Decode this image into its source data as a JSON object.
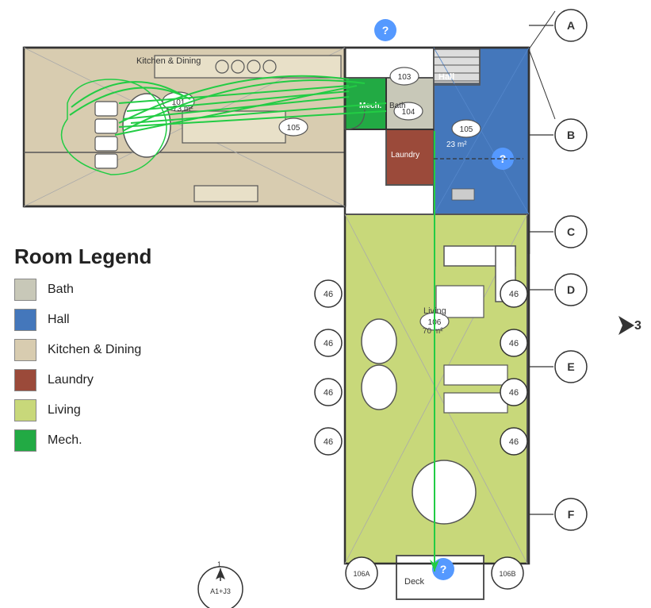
{
  "legend": {
    "title": "Room Legend",
    "items": [
      {
        "id": "bath",
        "label": "Bath",
        "color": "#c8d8c8"
      },
      {
        "id": "hall",
        "label": "Hall",
        "color": "#4477bb"
      },
      {
        "id": "kitchen-dining",
        "label": "Kitchen & Dining",
        "color": "#d8ccb0"
      },
      {
        "id": "laundry",
        "label": "Laundry",
        "color": "#9b4a3a"
      },
      {
        "id": "living",
        "label": "Living",
        "color": "#c8d87a"
      },
      {
        "id": "mech",
        "label": "Mech.",
        "color": "#22aa44"
      }
    ]
  },
  "rooms": [
    {
      "id": "kitchen-dining",
      "label": "Kitchen & Dining",
      "number": "101",
      "area": "73 m²"
    },
    {
      "id": "bath",
      "label": "Bath",
      "number": "104"
    },
    {
      "id": "hall",
      "label": "Hall",
      "number": "105",
      "area": "23 m²"
    },
    {
      "id": "living",
      "label": "Living",
      "number": "106",
      "area": "70 m²"
    },
    {
      "id": "mech",
      "label": "Mech.",
      "number": "103"
    },
    {
      "id": "laundry",
      "label": "Laundry"
    },
    {
      "id": "deck",
      "label": "Deck"
    }
  ],
  "grid_refs": {
    "right": [
      "A",
      "B",
      "C",
      "D",
      "E",
      "F"
    ],
    "bottom_number": "3",
    "ref_number": "1",
    "ref_label_bottom": "A1+J3"
  },
  "circle_markers": [
    "46",
    "46",
    "46",
    "46",
    "46",
    "46",
    "46",
    "46",
    "106A",
    "106B"
  ],
  "north_arrow": "↑"
}
